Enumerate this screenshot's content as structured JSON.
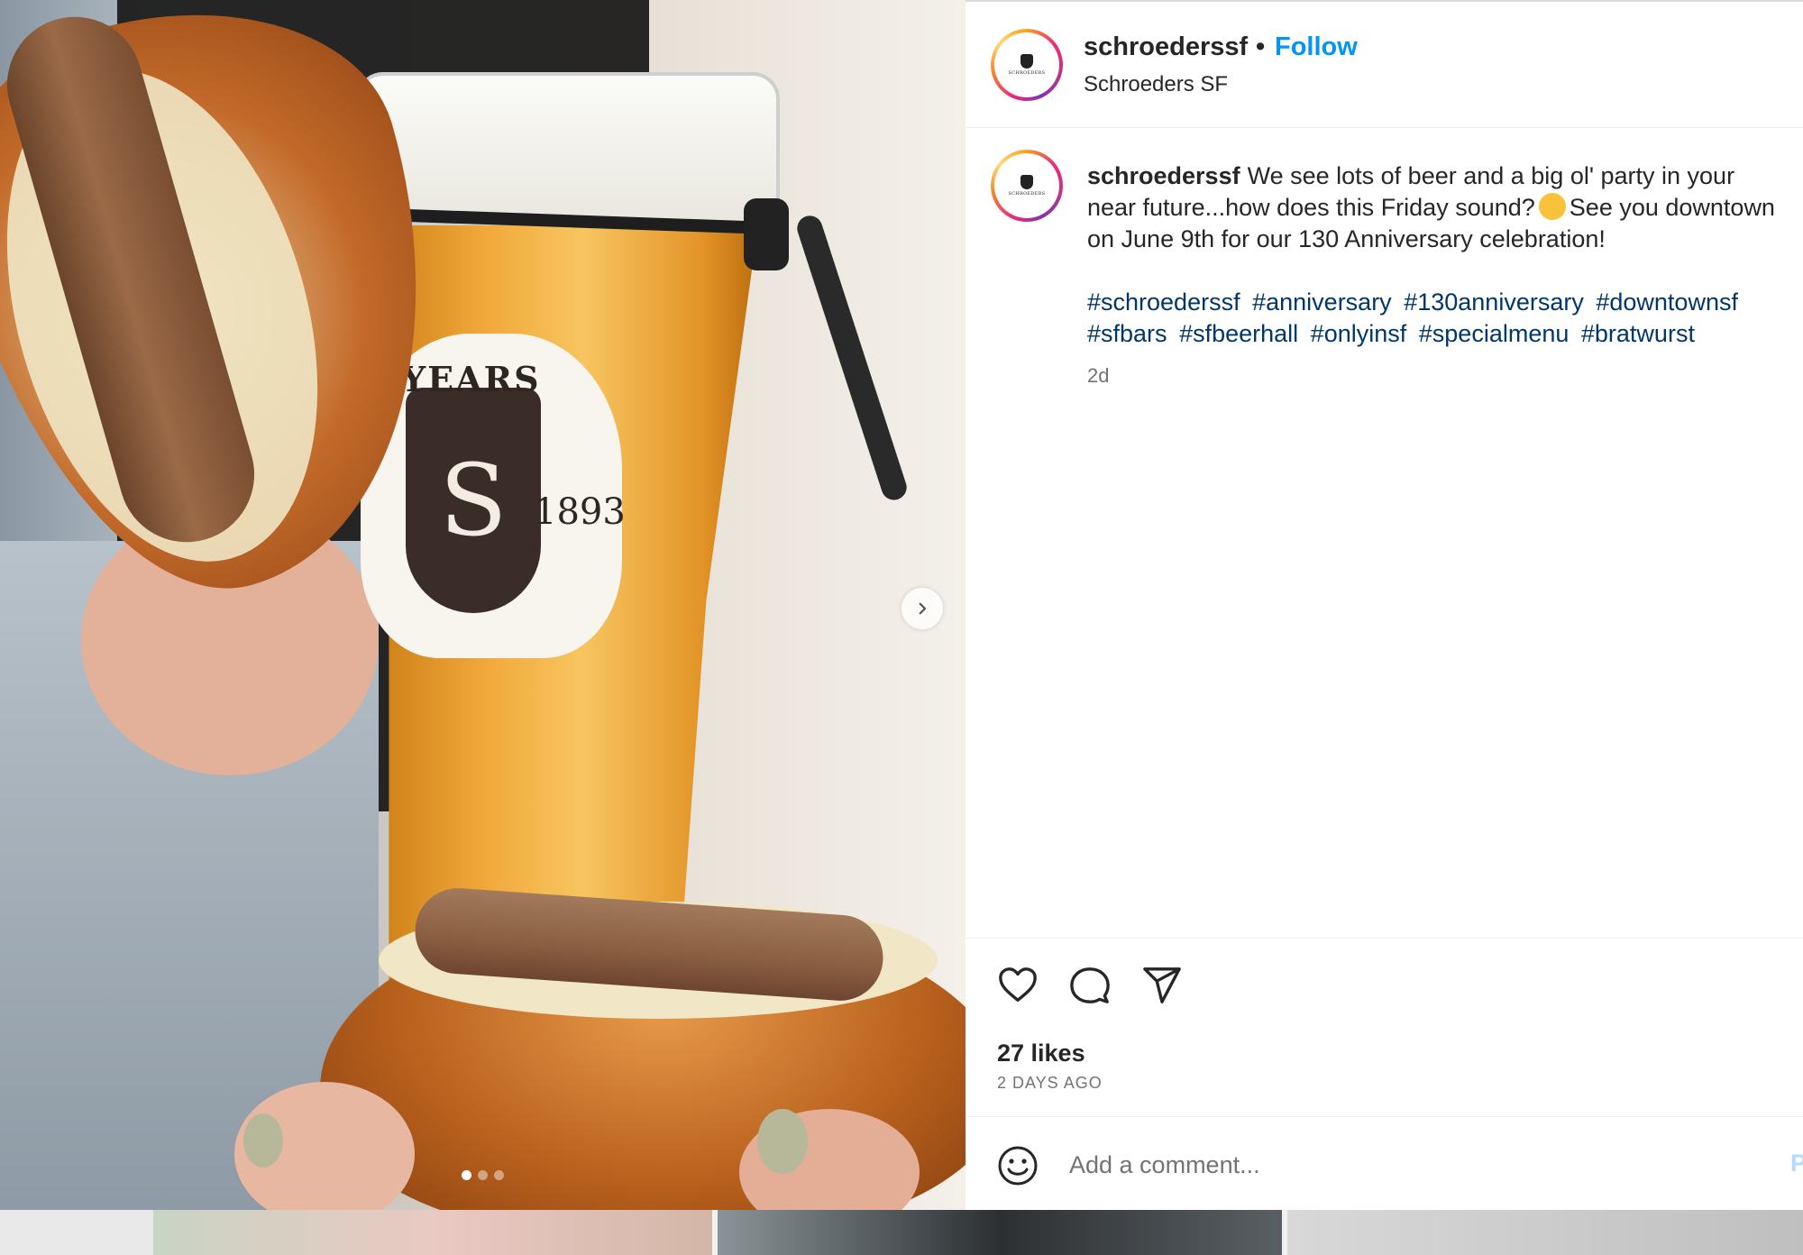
{
  "post": {
    "username": "schroederssf",
    "bullet": "•",
    "follow_label": "Follow",
    "subtitle": "Schroeders SF",
    "avatar_wordmark": "SCHROEDERS",
    "caption_text": "We see lots of beer and a big ol' party in your near future...how does this Friday sound?",
    "caption_text_2": "See you downtown on June 9th for our 130 Anniversary celebration!",
    "hashtags": [
      "#schroederssf",
      "#anniversary",
      "#130anniversary",
      "#downtownsf",
      "#sfbars",
      "#sfbeerhall",
      "#onlyinsf",
      "#specialmenu",
      "#bratwurst"
    ],
    "age": "2d",
    "likes": "27 likes",
    "date": "2 DAYS AGO",
    "comment_placeholder": "Add a comment...",
    "post_label": "P"
  },
  "media": {
    "decal_text_years": "YEARS",
    "decal_text_year": "1893",
    "carousel_count": 3,
    "carousel_active": 0
  },
  "icons": {
    "like": "heart-icon",
    "comment": "comment-icon",
    "share": "share-icon",
    "emoji": "emoji-icon",
    "next": "chevron-right-icon"
  },
  "colors": {
    "accent": "#0095f6",
    "hashtag": "#00376b",
    "muted": "#737373",
    "text": "#262626"
  }
}
